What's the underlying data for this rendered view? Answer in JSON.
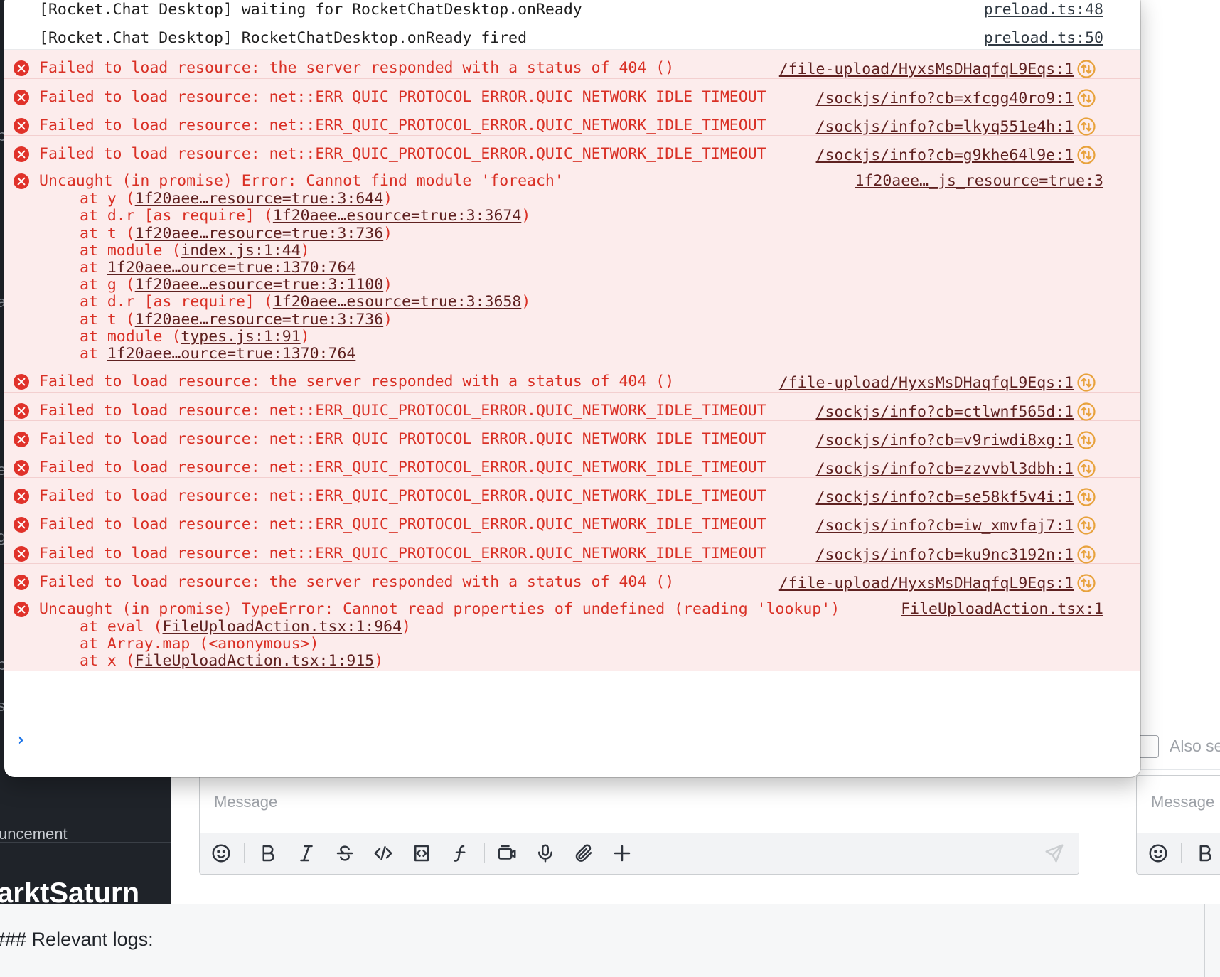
{
  "background": {
    "sidebar": {
      "partial_letters": [
        "p",
        "a",
        "e",
        "g",
        "p",
        "s"
      ],
      "announcement_text": "uncement",
      "workspace_name": "arktSaturn"
    },
    "main": {
      "message_placeholder": "Message",
      "also_send_label": "Also se",
      "right_message_placeholder": "Message"
    },
    "toolbar": {
      "icons": [
        "emoji-icon",
        "bold-icon",
        "italic-icon",
        "strikethrough-icon",
        "inline-code-icon",
        "code-block-icon",
        "formula-icon",
        "video-message-icon",
        "audio-message-icon",
        "attachment-icon",
        "plus-icon",
        "send-icon"
      ]
    },
    "below": {
      "heading": "### Relevant logs:"
    }
  },
  "console": {
    "messages": [
      {
        "level": "info",
        "text": "[Rocket.Chat Desktop] waiting for RocketChatDesktop.onReady",
        "source": "preload.ts:48"
      },
      {
        "level": "info",
        "text": "[Rocket.Chat Desktop] RocketChatDesktop.onReady fired",
        "source": "preload.ts:50"
      },
      {
        "level": "error",
        "text": "Failed to load resource: the server responded with a status of 404 ()",
        "source": "/file-upload/HyxsMsDHaqfqL9Eqs:1",
        "network": true
      },
      {
        "level": "error",
        "text": "Failed to load resource: net::ERR_QUIC_PROTOCOL_ERROR.QUIC_NETWORK_IDLE_TIMEOUT",
        "source": "/sockjs/info?cb=xfcgg40ro9:1",
        "network": true
      },
      {
        "level": "error",
        "text": "Failed to load resource: net::ERR_QUIC_PROTOCOL_ERROR.QUIC_NETWORK_IDLE_TIMEOUT",
        "source": "/sockjs/info?cb=lkyq551e4h:1",
        "network": true
      },
      {
        "level": "error",
        "text": "Failed to load resource: net::ERR_QUIC_PROTOCOL_ERROR.QUIC_NETWORK_IDLE_TIMEOUT",
        "source": "/sockjs/info?cb=g9khe64l9e:1",
        "network": true
      },
      {
        "level": "error",
        "text": "Uncaught (in promise) Error: Cannot find module 'foreach'",
        "source": "1f20aee…_js_resource=true:3",
        "stack": [
          {
            "pre": "at y (",
            "link": "1f20aee…resource=true:3:644",
            "post": ")"
          },
          {
            "pre": "at d.r [as require] (",
            "link": "1f20aee…esource=true:3:3674",
            "post": ")"
          },
          {
            "pre": "at t (",
            "link": "1f20aee…resource=true:3:736",
            "post": ")"
          },
          {
            "pre": "at module (",
            "link": "index.js:1:44",
            "post": ")"
          },
          {
            "pre": "at ",
            "link": "1f20aee…ource=true:1370:764",
            "post": ""
          },
          {
            "pre": "at g (",
            "link": "1f20aee…esource=true:3:1100",
            "post": ")"
          },
          {
            "pre": "at d.r [as require] (",
            "link": "1f20aee…esource=true:3:3658",
            "post": ")"
          },
          {
            "pre": "at t (",
            "link": "1f20aee…resource=true:3:736",
            "post": ")"
          },
          {
            "pre": "at module (",
            "link": "types.js:1:91",
            "post": ")"
          },
          {
            "pre": "at ",
            "link": "1f20aee…ource=true:1370:764",
            "post": ""
          }
        ]
      },
      {
        "level": "error",
        "text": "Failed to load resource: the server responded with a status of 404 ()",
        "source": "/file-upload/HyxsMsDHaqfqL9Eqs:1",
        "network": true
      },
      {
        "level": "error",
        "text": "Failed to load resource: net::ERR_QUIC_PROTOCOL_ERROR.QUIC_NETWORK_IDLE_TIMEOUT",
        "source": "/sockjs/info?cb=ctlwnf565d:1",
        "network": true
      },
      {
        "level": "error",
        "text": "Failed to load resource: net::ERR_QUIC_PROTOCOL_ERROR.QUIC_NETWORK_IDLE_TIMEOUT",
        "source": "/sockjs/info?cb=v9riwdi8xg:1",
        "network": true
      },
      {
        "level": "error",
        "text": "Failed to load resource: net::ERR_QUIC_PROTOCOL_ERROR.QUIC_NETWORK_IDLE_TIMEOUT",
        "source": "/sockjs/info?cb=zzvvbl3dbh:1",
        "network": true
      },
      {
        "level": "error",
        "text": "Failed to load resource: net::ERR_QUIC_PROTOCOL_ERROR.QUIC_NETWORK_IDLE_TIMEOUT",
        "source": "/sockjs/info?cb=se58kf5v4i:1",
        "network": true
      },
      {
        "level": "error",
        "text": "Failed to load resource: net::ERR_QUIC_PROTOCOL_ERROR.QUIC_NETWORK_IDLE_TIMEOUT",
        "source": "/sockjs/info?cb=iw_xmvfaj7:1",
        "network": true
      },
      {
        "level": "error",
        "text": "Failed to load resource: net::ERR_QUIC_PROTOCOL_ERROR.QUIC_NETWORK_IDLE_TIMEOUT",
        "source": "/sockjs/info?cb=ku9nc3192n:1",
        "network": true
      },
      {
        "level": "error",
        "text": "Failed to load resource: the server responded with a status of 404 ()",
        "source": "/file-upload/HyxsMsDHaqfqL9Eqs:1",
        "network": true
      },
      {
        "level": "error",
        "text": "Uncaught (in promise) TypeError: Cannot read properties of undefined (reading 'lookup')",
        "source": "FileUploadAction.tsx:1",
        "stack": [
          {
            "pre": "at eval (",
            "link": "FileUploadAction.tsx:1:964",
            "post": ")"
          },
          {
            "pre": "at Array.map (<anonymous>)",
            "link": "",
            "post": ""
          },
          {
            "pre": "at x (",
            "link": "FileUploadAction.tsx:1:915",
            "post": ")"
          }
        ]
      }
    ],
    "prompt_symbol": "›",
    "colors": {
      "error_text": "#d93025",
      "error_bg": "#fcecec",
      "error_icon": "#e0322a",
      "network_icon": "#e8a23c",
      "prompt": "#1a73e8"
    }
  }
}
